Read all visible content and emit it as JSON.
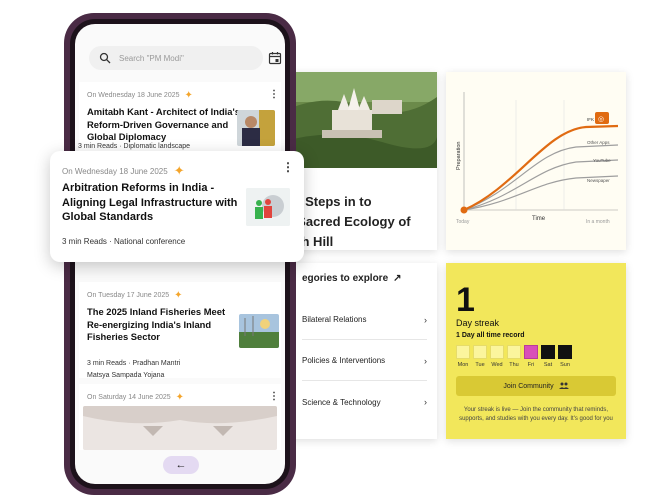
{
  "search": {
    "placeholder": "Search \"PM Modi\""
  },
  "feed": [
    {
      "date": "On Wednesday 18 June 2025",
      "title_lines": [
        "Amitabh Kant - Architect of India's",
        "Reform-Driven Governance and",
        "Global Diplomacy"
      ],
      "info_lines": [
        "3 min Reads · Diplomatic landscape"
      ]
    },
    {
      "date": "On Tuesday 17 June 2025",
      "title_lines": [
        "The 2025 Inland Fisheries Meet",
        "Re-energizing India's Inland",
        "Fisheries Sector"
      ],
      "info_lines": [
        "3 min Reads · Pradhan Mantri",
        "Matsya Sampada Yojana"
      ]
    },
    {
      "date": "On Saturday 14 June 2025"
    }
  ],
  "highlight": {
    "date": "On Wednesday 18 June 2025",
    "title_lines": [
      "Arbitration Reforms in India -",
      "Aligning Legal Infrastructure with",
      "Global Standards"
    ],
    "info": "3 min Reads · National conference"
  },
  "article": {
    "title_lines": [
      "ary Steps in to",
      "ct Sacred Ecology of",
      "nath Hill"
    ]
  },
  "categories": {
    "heading": "egories to explore",
    "items": [
      "Bilateral Relations",
      "Policies & Interventions",
      "Science & Technology"
    ]
  },
  "graph": {
    "ylabel": "Preparation",
    "xlabel": "Time",
    "start_label": "Today",
    "end_label": "In a month",
    "series_labels": [
      "IFK",
      "Other Apps",
      "YouTube",
      "Newspaper"
    ],
    "accent": "#e06b12"
  },
  "streak": {
    "count": "1",
    "label": "Day streak",
    "record": "1 Day all time record",
    "days": [
      {
        "label": "Mon",
        "color": "#fbf59d"
      },
      {
        "label": "Tue",
        "color": "#fbf59d"
      },
      {
        "label": "Wed",
        "color": "#fbf59d"
      },
      {
        "label": "Thu",
        "color": "#fbf59d"
      },
      {
        "label": "Fri",
        "color": "#d94fb8"
      },
      {
        "label": "Sat",
        "color": "#111111"
      },
      {
        "label": "Sun",
        "color": "#111111"
      }
    ],
    "join_label": "Join Community",
    "note": "Your streak is live — Join the community that reminds, supports, and studies with you every day. It's good for you"
  },
  "colors": {
    "card_yellow": "#f2e75b",
    "phone_frame": "#4a2b45",
    "star": "#f4a52b"
  }
}
